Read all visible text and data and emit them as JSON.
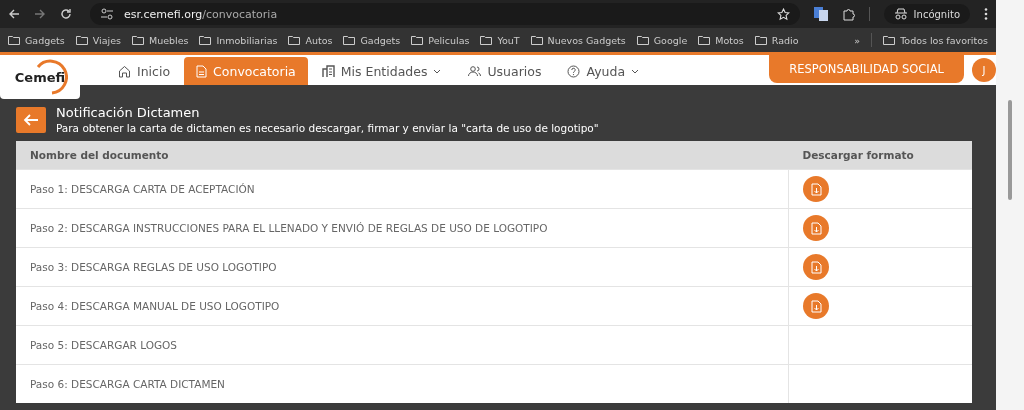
{
  "browser": {
    "url_host": "esr.cemefi.org",
    "url_path": "/convocatoria",
    "profile": "Incógnito",
    "bookmarks": [
      "Gadgets",
      "Viajes",
      "Muebles",
      "Inmobiliarias",
      "Autos",
      "Gadgets",
      "Peliculas",
      "YouT",
      "Nuevos Gadgets",
      "Google",
      "Motos",
      "Radio"
    ],
    "overflow": "»",
    "all_bookmarks": "Todos los favoritos"
  },
  "nav": {
    "logo": "Cemefi",
    "items": [
      {
        "label": "Inicio",
        "selected": false,
        "has_menu": false
      },
      {
        "label": "Convocatoria",
        "selected": true,
        "has_menu": false
      },
      {
        "label": "Mis Entidades",
        "selected": false,
        "has_menu": true
      },
      {
        "label": "Usuarios",
        "selected": false,
        "has_menu": false
      },
      {
        "label": "Ayuda",
        "selected": false,
        "has_menu": true
      }
    ],
    "brand_button": "RESPONSABILIDAD SOCIAL",
    "avatar": "J"
  },
  "notice": {
    "title": "Notificación Dictamen",
    "subtitle": "Para obtener la carta de dictamen es necesario descargar, firmar y enviar la \"carta de uso de logotipo\""
  },
  "table": {
    "columns": [
      "Nombre del documento",
      "Descargar formato"
    ],
    "rows": [
      {
        "name": "Paso 1: DESCARGA CARTA DE ACEPTACIÓN",
        "download": true
      },
      {
        "name": "Paso 2: DESCARGA INSTRUCCIONES PARA EL LLENADO Y ENVIÓ DE REGLAS DE USO DE LOGOTIPO",
        "download": true
      },
      {
        "name": "Paso 3: DESCARGA REGLAS DE USO LOGOTIPO",
        "download": true
      },
      {
        "name": "Paso 4: DESCARGA MANUAL DE USO LOGOTIPO",
        "download": true
      },
      {
        "name": "Paso 5: DESCARGAR LOGOS",
        "download": false
      },
      {
        "name": "Paso 6: DESCARGA CARTA DICTAMEN",
        "download": false
      }
    ]
  }
}
